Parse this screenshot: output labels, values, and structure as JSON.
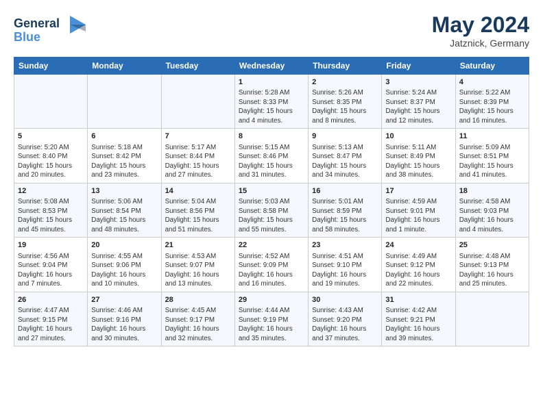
{
  "header": {
    "logo_line1": "General",
    "logo_line2": "Blue",
    "month": "May 2024",
    "location": "Jatznick, Germany"
  },
  "weekdays": [
    "Sunday",
    "Monday",
    "Tuesday",
    "Wednesday",
    "Thursday",
    "Friday",
    "Saturday"
  ],
  "weeks": [
    [
      {
        "day": "",
        "content": ""
      },
      {
        "day": "",
        "content": ""
      },
      {
        "day": "",
        "content": ""
      },
      {
        "day": "1",
        "content": "Sunrise: 5:28 AM\nSunset: 8:33 PM\nDaylight: 15 hours\nand 4 minutes."
      },
      {
        "day": "2",
        "content": "Sunrise: 5:26 AM\nSunset: 8:35 PM\nDaylight: 15 hours\nand 8 minutes."
      },
      {
        "day": "3",
        "content": "Sunrise: 5:24 AM\nSunset: 8:37 PM\nDaylight: 15 hours\nand 12 minutes."
      },
      {
        "day": "4",
        "content": "Sunrise: 5:22 AM\nSunset: 8:39 PM\nDaylight: 15 hours\nand 16 minutes."
      }
    ],
    [
      {
        "day": "5",
        "content": "Sunrise: 5:20 AM\nSunset: 8:40 PM\nDaylight: 15 hours\nand 20 minutes."
      },
      {
        "day": "6",
        "content": "Sunrise: 5:18 AM\nSunset: 8:42 PM\nDaylight: 15 hours\nand 23 minutes."
      },
      {
        "day": "7",
        "content": "Sunrise: 5:17 AM\nSunset: 8:44 PM\nDaylight: 15 hours\nand 27 minutes."
      },
      {
        "day": "8",
        "content": "Sunrise: 5:15 AM\nSunset: 8:46 PM\nDaylight: 15 hours\nand 31 minutes."
      },
      {
        "day": "9",
        "content": "Sunrise: 5:13 AM\nSunset: 8:47 PM\nDaylight: 15 hours\nand 34 minutes."
      },
      {
        "day": "10",
        "content": "Sunrise: 5:11 AM\nSunset: 8:49 PM\nDaylight: 15 hours\nand 38 minutes."
      },
      {
        "day": "11",
        "content": "Sunrise: 5:09 AM\nSunset: 8:51 PM\nDaylight: 15 hours\nand 41 minutes."
      }
    ],
    [
      {
        "day": "12",
        "content": "Sunrise: 5:08 AM\nSunset: 8:53 PM\nDaylight: 15 hours\nand 45 minutes."
      },
      {
        "day": "13",
        "content": "Sunrise: 5:06 AM\nSunset: 8:54 PM\nDaylight: 15 hours\nand 48 minutes."
      },
      {
        "day": "14",
        "content": "Sunrise: 5:04 AM\nSunset: 8:56 PM\nDaylight: 15 hours\nand 51 minutes."
      },
      {
        "day": "15",
        "content": "Sunrise: 5:03 AM\nSunset: 8:58 PM\nDaylight: 15 hours\nand 55 minutes."
      },
      {
        "day": "16",
        "content": "Sunrise: 5:01 AM\nSunset: 8:59 PM\nDaylight: 15 hours\nand 58 minutes."
      },
      {
        "day": "17",
        "content": "Sunrise: 4:59 AM\nSunset: 9:01 PM\nDaylight: 16 hours\nand 1 minute."
      },
      {
        "day": "18",
        "content": "Sunrise: 4:58 AM\nSunset: 9:03 PM\nDaylight: 16 hours\nand 4 minutes."
      }
    ],
    [
      {
        "day": "19",
        "content": "Sunrise: 4:56 AM\nSunset: 9:04 PM\nDaylight: 16 hours\nand 7 minutes."
      },
      {
        "day": "20",
        "content": "Sunrise: 4:55 AM\nSunset: 9:06 PM\nDaylight: 16 hours\nand 10 minutes."
      },
      {
        "day": "21",
        "content": "Sunrise: 4:53 AM\nSunset: 9:07 PM\nDaylight: 16 hours\nand 13 minutes."
      },
      {
        "day": "22",
        "content": "Sunrise: 4:52 AM\nSunset: 9:09 PM\nDaylight: 16 hours\nand 16 minutes."
      },
      {
        "day": "23",
        "content": "Sunrise: 4:51 AM\nSunset: 9:10 PM\nDaylight: 16 hours\nand 19 minutes."
      },
      {
        "day": "24",
        "content": "Sunrise: 4:49 AM\nSunset: 9:12 PM\nDaylight: 16 hours\nand 22 minutes."
      },
      {
        "day": "25",
        "content": "Sunrise: 4:48 AM\nSunset: 9:13 PM\nDaylight: 16 hours\nand 25 minutes."
      }
    ],
    [
      {
        "day": "26",
        "content": "Sunrise: 4:47 AM\nSunset: 9:15 PM\nDaylight: 16 hours\nand 27 minutes."
      },
      {
        "day": "27",
        "content": "Sunrise: 4:46 AM\nSunset: 9:16 PM\nDaylight: 16 hours\nand 30 minutes."
      },
      {
        "day": "28",
        "content": "Sunrise: 4:45 AM\nSunset: 9:17 PM\nDaylight: 16 hours\nand 32 minutes."
      },
      {
        "day": "29",
        "content": "Sunrise: 4:44 AM\nSunset: 9:19 PM\nDaylight: 16 hours\nand 35 minutes."
      },
      {
        "day": "30",
        "content": "Sunrise: 4:43 AM\nSunset: 9:20 PM\nDaylight: 16 hours\nand 37 minutes."
      },
      {
        "day": "31",
        "content": "Sunrise: 4:42 AM\nSunset: 9:21 PM\nDaylight: 16 hours\nand 39 minutes."
      },
      {
        "day": "",
        "content": ""
      }
    ]
  ]
}
